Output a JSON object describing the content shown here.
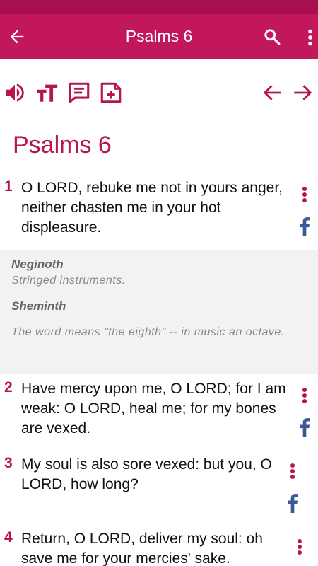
{
  "app_bar": {
    "title": "Psalms 6"
  },
  "chapter_heading": "Psalms 6",
  "colors": {
    "primary": "#c2185b",
    "status_bar": "#a80f4f",
    "accent": "#b5164f",
    "facebook": "#3b5998"
  },
  "icons": [
    "back-arrow-icon",
    "search-icon",
    "more-vert-icon",
    "speaker-icon",
    "text-size-icon",
    "comment-icon",
    "add-note-icon",
    "prev-chapter-arrow-icon",
    "next-chapter-arrow-icon",
    "facebook-icon"
  ],
  "verses": [
    {
      "num": "1",
      "text": "O LORD, rebuke me not in yours anger, neither chasten me in your hot displeasure."
    },
    {
      "num": "2",
      "text": "Have mercy upon me, O LORD; for I am weak: O LORD, heal me; for my bones are vexed."
    },
    {
      "num": "3",
      "text": "My soul is also sore vexed: but you, O LORD, how long?"
    },
    {
      "num": "4",
      "text": "Return, O LORD, deliver my soul: oh save me for your mercies' sake."
    }
  ],
  "notes": [
    {
      "term": "Neginoth",
      "definition": "Stringed instruments."
    },
    {
      "term": "Sheminth",
      "definition": "The word means \"the eighth\" -- in music an octave."
    }
  ]
}
